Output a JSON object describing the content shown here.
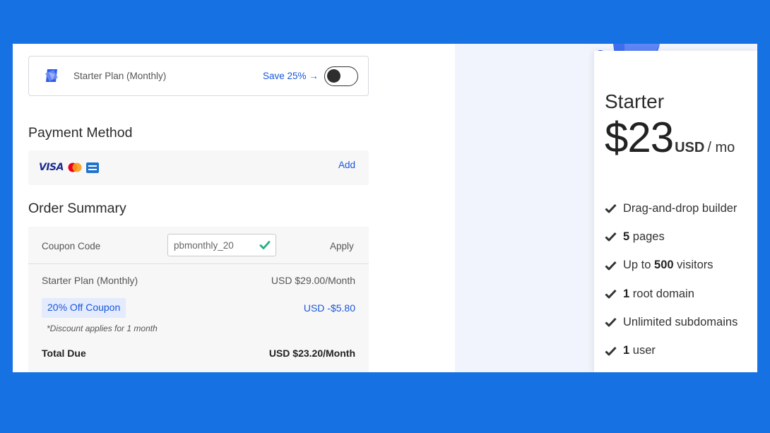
{
  "checkout": {
    "plan_bar": {
      "plan_name": "Starter Plan (Monthly)",
      "save_label": "Save 25% →",
      "toggle_on": false
    },
    "payment": {
      "title": "Payment Method",
      "card_brands": [
        "visa-icon",
        "mastercard-icon",
        "amex-icon"
      ],
      "visa_text": "VISA",
      "add_label": "Add"
    },
    "order": {
      "title": "Order Summary",
      "coupon_label": "Coupon Code",
      "coupon_value": "pbmonthly_20",
      "apply_label": "Apply",
      "plan_line_label": "Starter Plan (Monthly)",
      "plan_line_value": "USD $29.00/Month",
      "coupon_badge": "20% Off Coupon",
      "discount_value": "USD -$5.80",
      "discount_note": "*Discount applies for 1 month",
      "total_label": "Total Due",
      "total_value": "USD $23.20/Month"
    }
  },
  "pricing_card": {
    "tier": "Starter",
    "price": "$23",
    "currency": "USD",
    "period": "/ mo",
    "features": [
      {
        "pre": "",
        "bold": "",
        "post": "Drag-and-drop builder"
      },
      {
        "pre": "",
        "bold": "5",
        "post": " pages"
      },
      {
        "pre": "Up to ",
        "bold": "500",
        "post": " visitors"
      },
      {
        "pre": "",
        "bold": "1",
        "post": " root domain"
      },
      {
        "pre": "",
        "bold": "",
        "post": "Unlimited subdomains"
      },
      {
        "pre": "",
        "bold": "1",
        "post": " user"
      }
    ]
  },
  "colors": {
    "background": "#1672E2",
    "accent": "#1a56db",
    "success": "#22b07d",
    "badge_bg": "#E3EBFC"
  }
}
